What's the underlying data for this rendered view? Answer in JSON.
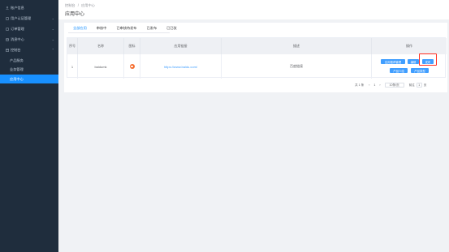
{
  "sidebar": {
    "items": [
      {
        "label": "账户信息",
        "icon": "user-icon"
      },
      {
        "label": "用户认证管理",
        "icon": "id-card-icon",
        "chev": "⌄"
      },
      {
        "label": "订单管理",
        "icon": "order-icon",
        "chev": "⌄"
      },
      {
        "label": "消息中心",
        "icon": "message-icon",
        "chev": "⌄"
      },
      {
        "label": "控制台",
        "icon": "console-icon",
        "chev": "⌃"
      },
      {
        "label": "产品服务",
        "sub": true
      },
      {
        "label": "业务管理",
        "sub": true
      },
      {
        "label": "应用中心",
        "sub": true,
        "active": true
      }
    ]
  },
  "breadcrumb": {
    "parent": "控制台",
    "separator": "/",
    "current": "应用中心"
  },
  "page_title": "应用中心",
  "tabs": [
    "全部应用",
    "审核中",
    "已审核待发布",
    "已发布",
    "已已驳"
  ],
  "table": {
    "headers": [
      "序号",
      "名称",
      "图标",
      "应用链接",
      "描述",
      "操作"
    ],
    "rows": [
      {
        "index": "1",
        "name": "baidumk",
        "link": "https://www.baidu.com/",
        "description": "百度链接"
      }
    ],
    "actions": [
      "应用推荐管理",
      "编辑",
      "发布",
      "产品介绍",
      "产品类型"
    ]
  },
  "pagination": {
    "total": "共 1 条",
    "prev": "‹",
    "page": "1",
    "next": "›",
    "page_size": "10条/页",
    "goto_label": "前往",
    "goto_value": "1",
    "page_unit": "页"
  },
  "colors": {
    "sidebar_bg": "#1f2d3d",
    "accent": "#1890ff",
    "button": "#409eff",
    "highlight": "#ff2d20"
  }
}
